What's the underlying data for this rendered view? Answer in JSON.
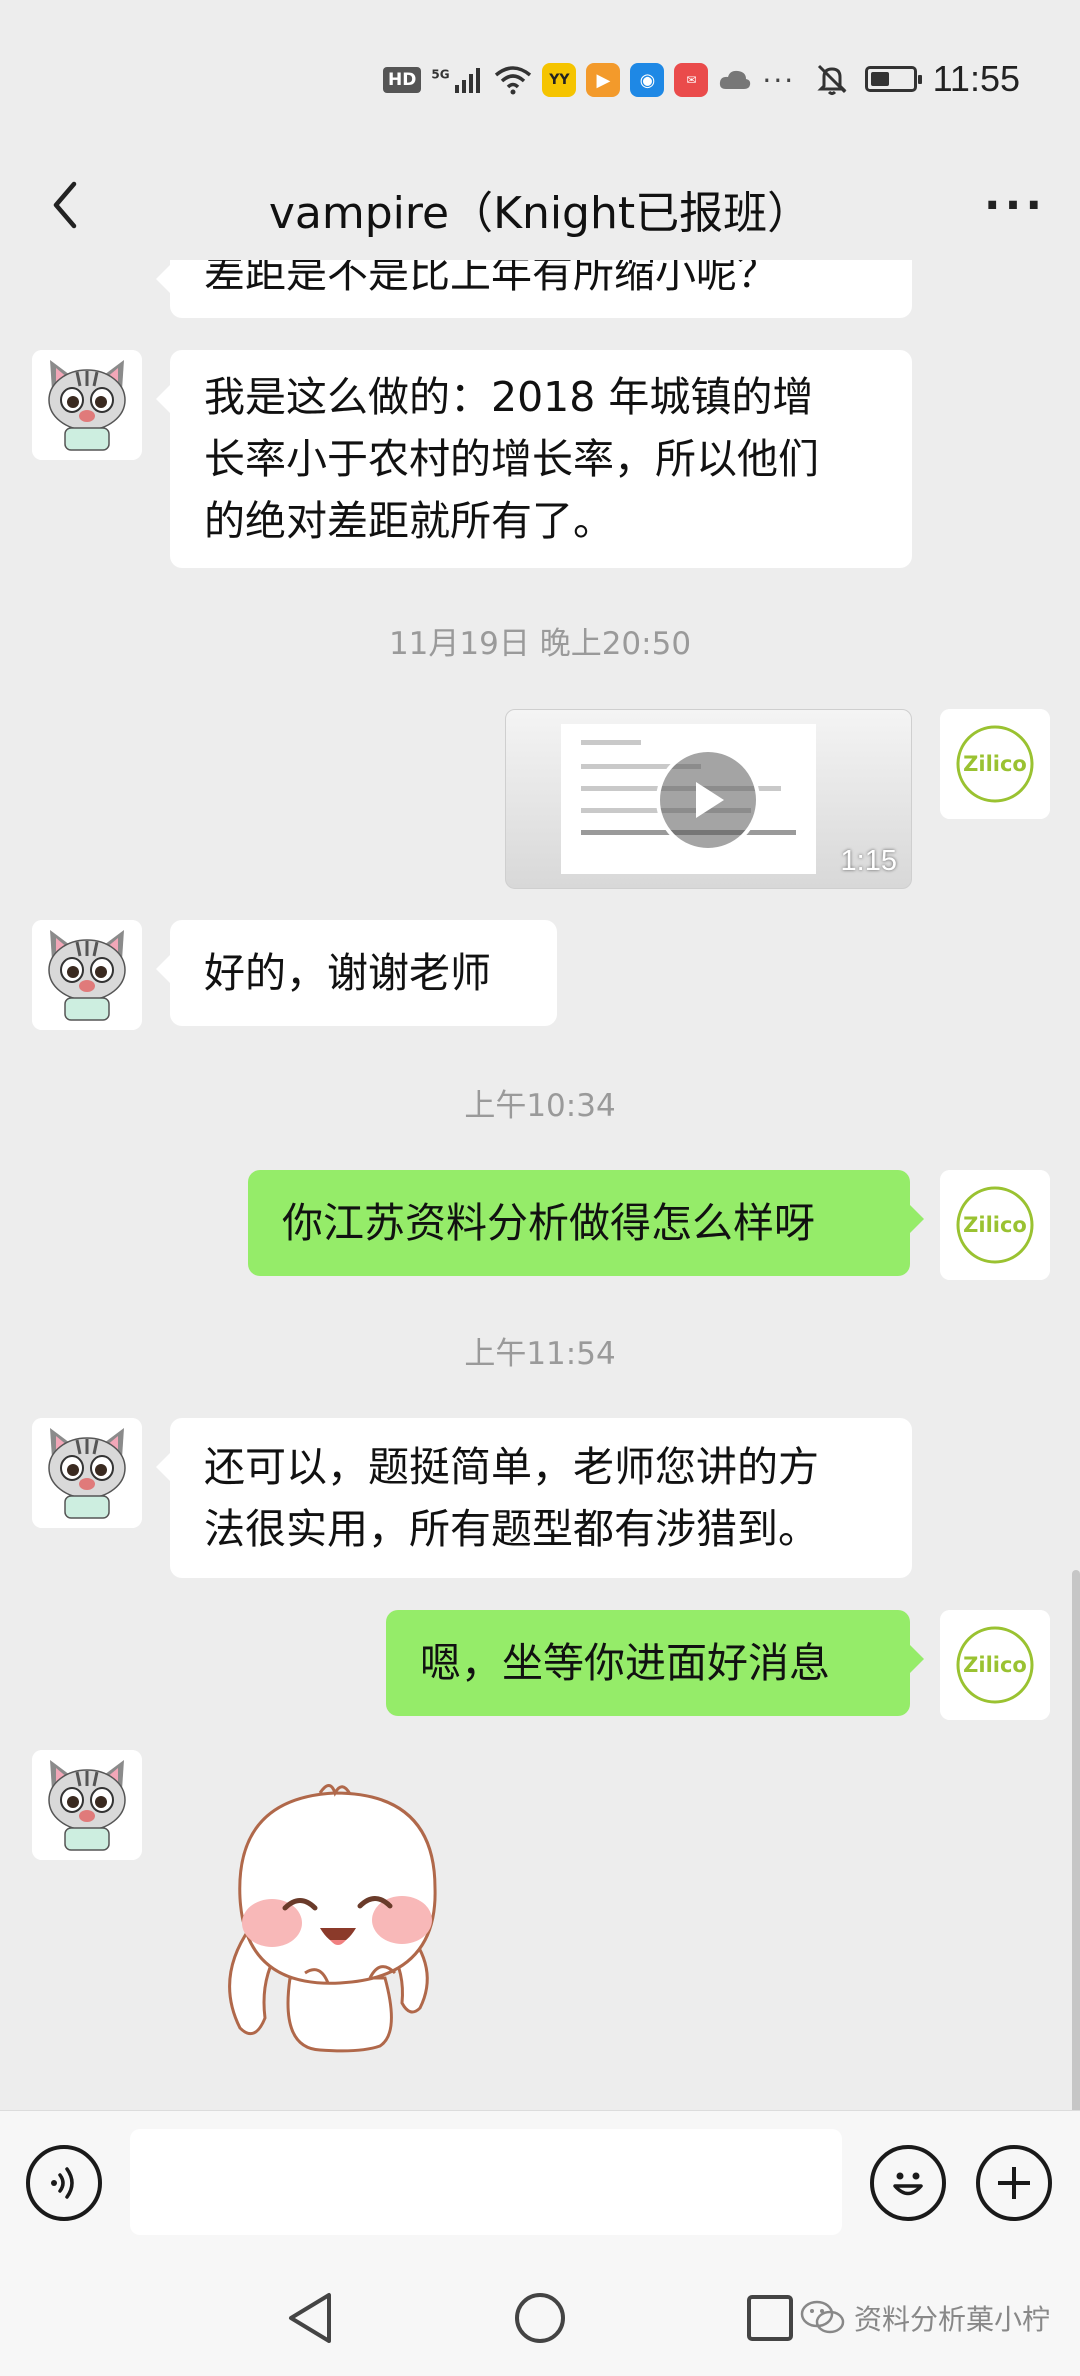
{
  "status_bar": {
    "time": "11:55",
    "network": "5G",
    "hd": "HD",
    "battery_level": 0.45
  },
  "header": {
    "title": "vampire（Knight已报班）",
    "back_icon": "chevron-left-icon",
    "more_icon": "more-dots-icon"
  },
  "messages": [
    {
      "side": "left",
      "type": "text",
      "text": "差距是不是比上年有所缩小呢？"
    },
    {
      "side": "left",
      "type": "text",
      "lines": [
        "我是这么做的：2018 年城镇的增",
        "长率小于农村的增长率，所以他们",
        "的绝对差距就所有了。"
      ]
    },
    {
      "type": "timestamp",
      "text": "11月19日 晚上20:50"
    },
    {
      "side": "right",
      "type": "video",
      "duration": "1:15"
    },
    {
      "side": "left",
      "type": "text",
      "text": "好的，谢谢老师"
    },
    {
      "type": "timestamp",
      "text": "上午10:34"
    },
    {
      "side": "right",
      "type": "text",
      "text": "你江苏资料分析做得怎么样呀"
    },
    {
      "type": "timestamp",
      "text": "上午11:54"
    },
    {
      "side": "left",
      "type": "text",
      "lines": [
        "还可以，题挺简单，老师您讲的方",
        "法很实用，所有题型都有涉猎到。"
      ]
    },
    {
      "side": "right",
      "type": "text",
      "text": "嗯，坐等你进面好消息"
    },
    {
      "side": "left",
      "type": "sticker",
      "sticker_icon": "bunny-sticker-icon"
    }
  ],
  "right_avatar_text": "Zilico",
  "input_bar": {
    "placeholder": "",
    "voice_icon": "voice-icon",
    "emoji_icon": "emoji-icon",
    "plus_icon": "plus-icon"
  },
  "watermark": "资料分析菓小柠",
  "colors": {
    "background": "#ededed",
    "sent_bubble": "#95ec69",
    "received_bubble": "#ffffff",
    "timestamp_text": "#9a9a9a",
    "avatar_logo": "#9ac231"
  }
}
